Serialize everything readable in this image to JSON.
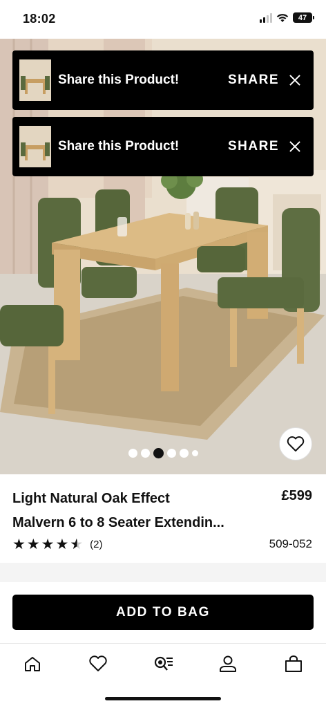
{
  "status_bar": {
    "time": "18:02",
    "battery": "47"
  },
  "toasts": [
    {
      "text": "Share this Product!",
      "action": "SHARE"
    },
    {
      "text": "Share this Product!",
      "action": "SHARE"
    }
  ],
  "carousel": {
    "total": 6,
    "active_index": 2
  },
  "product": {
    "title_line1": "Light Natural Oak Effect",
    "title_line2": "Malvern 6 to 8 Seater Extendin...",
    "price": "£599",
    "rating": 4.5,
    "review_count": "(2)",
    "item_code": "509-052"
  },
  "cta": {
    "add_to_bag": "ADD TO BAG"
  },
  "bottom_nav": {
    "items": [
      {
        "icon": "home-icon"
      },
      {
        "icon": "heart-icon"
      },
      {
        "icon": "search-list-icon"
      },
      {
        "icon": "account-icon"
      },
      {
        "icon": "bag-icon"
      }
    ]
  },
  "colors": {
    "accent": "#000000",
    "chair_green": "#5a6a3e",
    "wood": "#d9b57e"
  }
}
